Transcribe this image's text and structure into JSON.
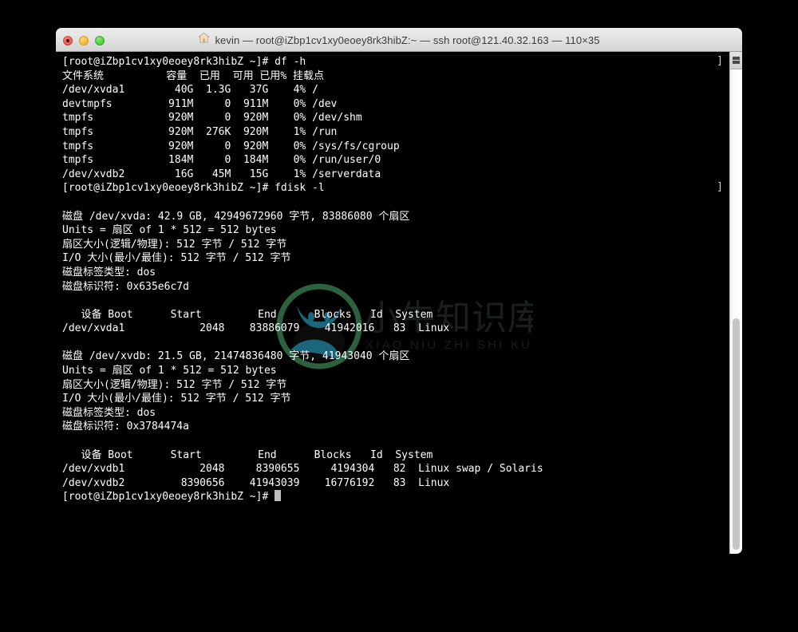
{
  "window": {
    "title": "kevin — root@iZbp1cv1xy0eoey8rk3hibZ:~ — ssh root@121.40.32.163 — 110×35",
    "icon": "home-icon",
    "traffic_lights": [
      {
        "name": "close-button",
        "color": "#f0655c"
      },
      {
        "name": "minimize-button",
        "color": "#f6bc45"
      },
      {
        "name": "maximize-button",
        "color": "#5ed14a"
      }
    ]
  },
  "terminal": {
    "prompt": "[root@iZbp1cv1xy0eoey8rk3hibZ ~]#",
    "cursor_visible": true,
    "lines": [
      "[root@iZbp1cv1xy0eoey8rk3hibZ ~]# df -h",
      "文件系统          容量  已用  可用 已用% 挂载点",
      "/dev/xvda1        40G  1.3G   37G    4% /",
      "devtmpfs         911M     0  911M    0% /dev",
      "tmpfs            920M     0  920M    0% /dev/shm",
      "tmpfs            920M  276K  920M    1% /run",
      "tmpfs            920M     0  920M    0% /sys/fs/cgroup",
      "tmpfs            184M     0  184M    0% /run/user/0",
      "/dev/xvdb2        16G   45M   15G    1% /serverdata",
      "[root@iZbp1cv1xy0eoey8rk3hibZ ~]# fdisk -l",
      "",
      "磁盘 /dev/xvda: 42.9 GB, 42949672960 字节, 83886080 个扇区",
      "Units = 扇区 of 1 * 512 = 512 bytes",
      "扇区大小(逻辑/物理): 512 字节 / 512 字节",
      "I/O 大小(最小/最佳): 512 字节 / 512 字节",
      "磁盘标签类型: dos",
      "磁盘标识符: 0x635e6c7d",
      "",
      "   设备 Boot      Start         End      Blocks   Id  System",
      "/dev/xvda1            2048    83886079    41942016   83  Linux",
      "",
      "磁盘 /dev/xvdb: 21.5 GB, 21474836480 字节, 41943040 个扇区",
      "Units = 扇区 of 1 * 512 = 512 bytes",
      "扇区大小(逻辑/物理): 512 字节 / 512 字节",
      "I/O 大小(最小/最佳): 512 字节 / 512 字节",
      "磁盘标签类型: dos",
      "磁盘标识符: 0x3784474a",
      "",
      "   设备 Boot      Start         End      Blocks   Id  System",
      "/dev/xvdb1            2048     8390655     4194304   82  Linux swap / Solaris",
      "/dev/xvdb2         8390656    41943039    16776192   83  Linux"
    ],
    "wrap_markers": [
      "]",
      "]"
    ],
    "colors": {
      "background": "#000000",
      "foreground": "#ffffff",
      "cursor": "#bdbdbd"
    }
  },
  "watermark": {
    "text_cn": "小牛知识库",
    "text_en": "XIAO NIU ZHI SHI KU",
    "logo_colors": [
      "#3f7a4a",
      "#1f6f86"
    ]
  },
  "scrollbar": {
    "split_button": "scroll-split-button",
    "thumb": "scroll-thumb"
  }
}
